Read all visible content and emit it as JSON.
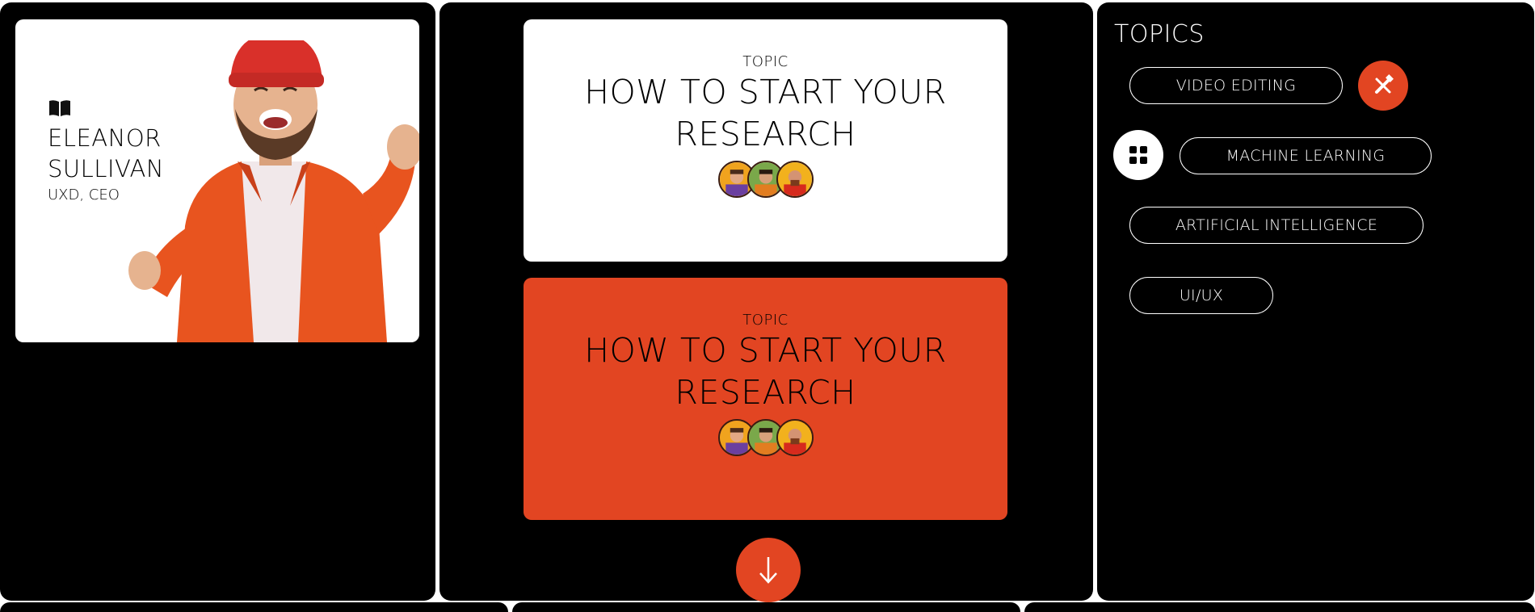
{
  "profile": {
    "first_name": "ELEANOR",
    "last_name": "SULLIVAN",
    "role": "UXD, CEO",
    "icon": "book-icon"
  },
  "cards": [
    {
      "eyebrow": "TOPIC",
      "title_line1": "HOW TO START YOUR",
      "title_line2": "RESEARCH",
      "background": "#ffffff"
    },
    {
      "eyebrow": "TOPIC",
      "title_line1": "HOW TO START YOUR",
      "title_line2": "RESEARCH",
      "background": "#e24522"
    }
  ],
  "scroll_button": {
    "icon": "arrow-down-icon",
    "glyph": "↓"
  },
  "topics": {
    "title": "TOPICS",
    "items": [
      {
        "label": "VIDEO EDITING"
      },
      {
        "label": "MACHINE LEARNING"
      },
      {
        "label": "ARTIFICIAL INTELLIGENCE"
      },
      {
        "label": "UI/UX"
      }
    ],
    "icons": [
      "edit-tools-icon",
      "grid-icon"
    ]
  },
  "colors": {
    "accent": "#e24522",
    "background": "#000000",
    "card": "#ffffff"
  }
}
